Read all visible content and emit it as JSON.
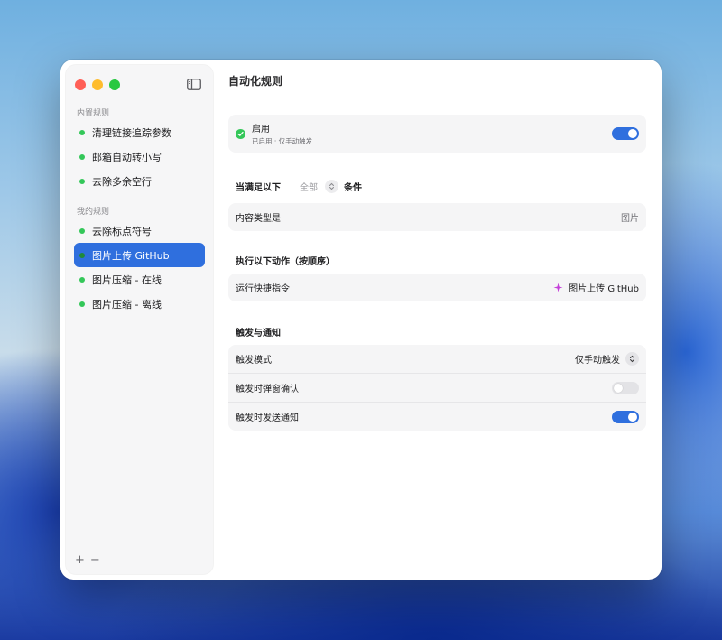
{
  "window": {
    "title": "自动化规则"
  },
  "sidebar": {
    "builtin_label": "内置规则",
    "builtin_items": [
      {
        "label": "清理链接追踪参数"
      },
      {
        "label": "邮箱自动转小写"
      },
      {
        "label": "去除多余空行"
      }
    ],
    "mine_label": "我的规则",
    "my_items": [
      {
        "label": "去除标点符号"
      },
      {
        "label": "图片上传 GitHub",
        "selected": true
      },
      {
        "label": "图片压缩 - 在线"
      },
      {
        "label": "图片压缩 - 离线"
      }
    ],
    "footer": {
      "add": "+",
      "remove": "−"
    }
  },
  "enable_card": {
    "title": "启用",
    "subtitle": "已启用 · 仅手动触发",
    "enabled": true
  },
  "condition": {
    "prefix": "当满足以下",
    "mode": "全部",
    "suffix": "条件",
    "row_label": "内容类型是",
    "row_value": "图片"
  },
  "actions": {
    "heading": "执行以下动作（按顺序）",
    "row_label": "运行快捷指令",
    "row_value": "图片上传 GitHub"
  },
  "trigger": {
    "heading": "触发与通知",
    "mode_label": "触发模式",
    "mode_value": "仅手动触发",
    "confirm_label": "触发时弹窗确认",
    "confirm_on": false,
    "notify_label": "触发时发送通知",
    "notify_on": true
  },
  "colors": {
    "accent": "#2f6fde",
    "status_green": "#34c759"
  }
}
